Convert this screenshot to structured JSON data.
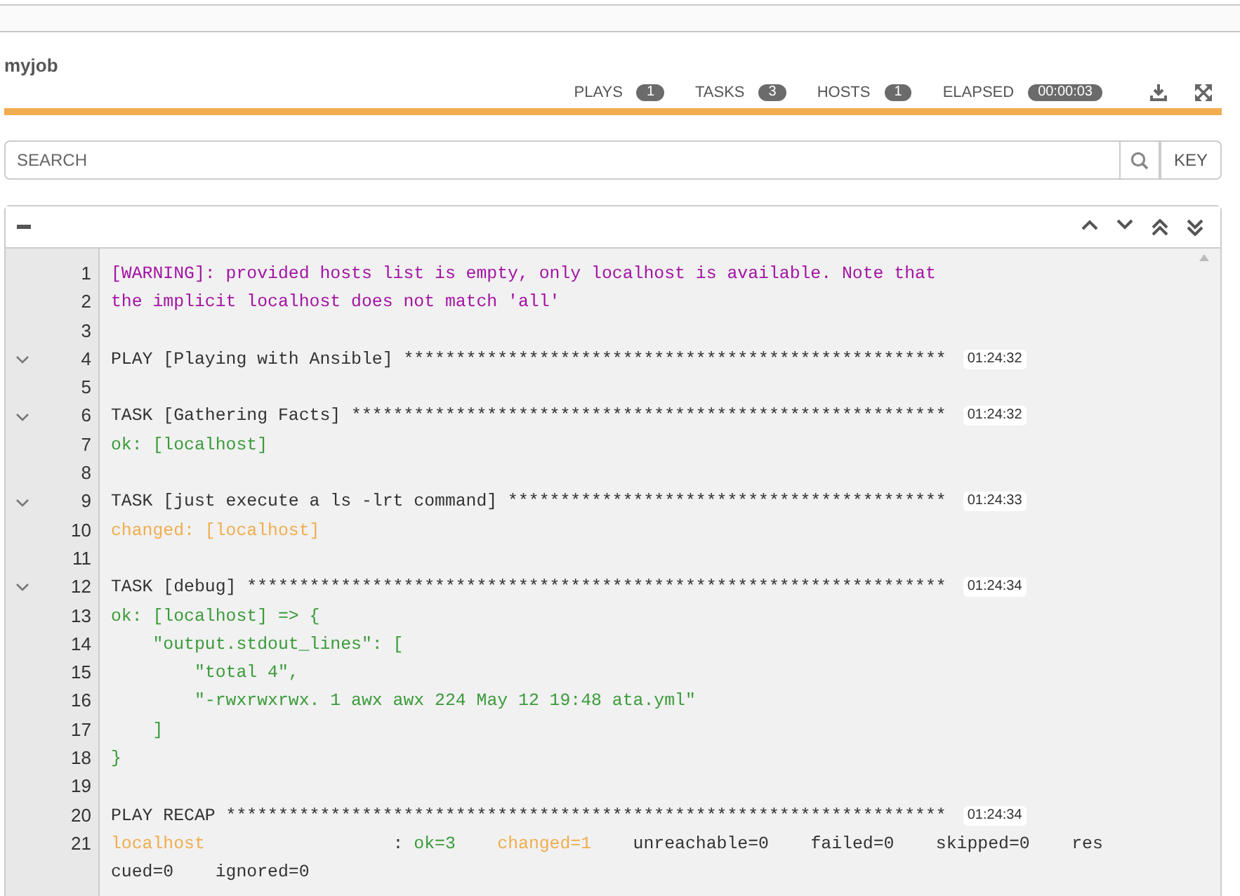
{
  "job": {
    "title": "myjob"
  },
  "stats": [
    {
      "label": "PLAYS",
      "count": "1"
    },
    {
      "label": "TASKS",
      "count": "3"
    },
    {
      "label": "HOSTS",
      "count": "1"
    },
    {
      "label": "ELAPSED",
      "count": "00:00:03"
    }
  ],
  "progress": {
    "level": 1
  },
  "search": {
    "placeholder": "SEARCH",
    "key_button": "KEY"
  },
  "output": {
    "lines": [
      {
        "number": "1",
        "segments": [
          {
            "text": "[WARNING]: provided hosts list is empty, only localhost is available. Note that",
            "kind": "warning"
          }
        ]
      },
      {
        "number": "2",
        "segments": [
          {
            "text": "the implicit localhost does not match 'all'",
            "kind": "warning"
          }
        ]
      },
      {
        "number": "3"
      },
      {
        "number": "4",
        "expanded": true,
        "segments": [
          {
            "text": "PLAY [Playing with Ansible] ****************************************************",
            "kind": "plain"
          }
        ],
        "timestamp": "01:24:32"
      },
      {
        "number": "5"
      },
      {
        "number": "6",
        "expanded": true,
        "segments": [
          {
            "text": "TASK [Gathering Facts] *********************************************************",
            "kind": "plain"
          }
        ],
        "timestamp": "01:24:32"
      },
      {
        "number": "7",
        "segments": [
          {
            "text": "ok: [localhost]",
            "kind": "ok"
          }
        ]
      },
      {
        "number": "8"
      },
      {
        "number": "9",
        "expanded": true,
        "segments": [
          {
            "text": "TASK [just execute a ls -lrt command] ******************************************",
            "kind": "plain"
          }
        ],
        "timestamp": "01:24:33"
      },
      {
        "number": "10",
        "segments": [
          {
            "text": "changed: [localhost]",
            "kind": "changed"
          }
        ]
      },
      {
        "number": "11"
      },
      {
        "number": "12",
        "expanded": true,
        "segments": [
          {
            "text": "TASK [debug] *******************************************************************",
            "kind": "plain"
          }
        ],
        "timestamp": "01:24:34"
      },
      {
        "number": "13",
        "segments": [
          {
            "text": "ok: [localhost] => {",
            "kind": "ok"
          }
        ]
      },
      {
        "number": "14",
        "segments": [
          {
            "text": "    \"output.stdout_lines\": [",
            "kind": "ok"
          }
        ]
      },
      {
        "number": "15",
        "segments": [
          {
            "text": "        \"total 4\",",
            "kind": "ok"
          }
        ]
      },
      {
        "number": "16",
        "segments": [
          {
            "text": "        \"-rwxrwxrwx. 1 awx awx 224 May 12 19:48 ata.yml\"",
            "kind": "ok"
          }
        ]
      },
      {
        "number": "17",
        "segments": [
          {
            "text": "    ]",
            "kind": "ok"
          }
        ]
      },
      {
        "number": "18",
        "segments": [
          {
            "text": "}",
            "kind": "ok"
          }
        ]
      },
      {
        "number": "19"
      },
      {
        "number": "20",
        "segments": [
          {
            "text": "PLAY RECAP *********************************************************************",
            "kind": "plain"
          }
        ],
        "timestamp": "01:24:34"
      },
      {
        "number": "21",
        "segments": [
          {
            "text": "localhost",
            "kind": "changed"
          },
          {
            "text": "                  : ",
            "kind": "plain"
          },
          {
            "text": "ok=3",
            "kind": "ok"
          },
          {
            "text": "    changed=1",
            "kind": "changed"
          },
          {
            "text": "    unreachable=0    failed=0    skipped=0    rescued=0    ignored=0",
            "kind": "plain"
          }
        ]
      }
    ]
  }
}
